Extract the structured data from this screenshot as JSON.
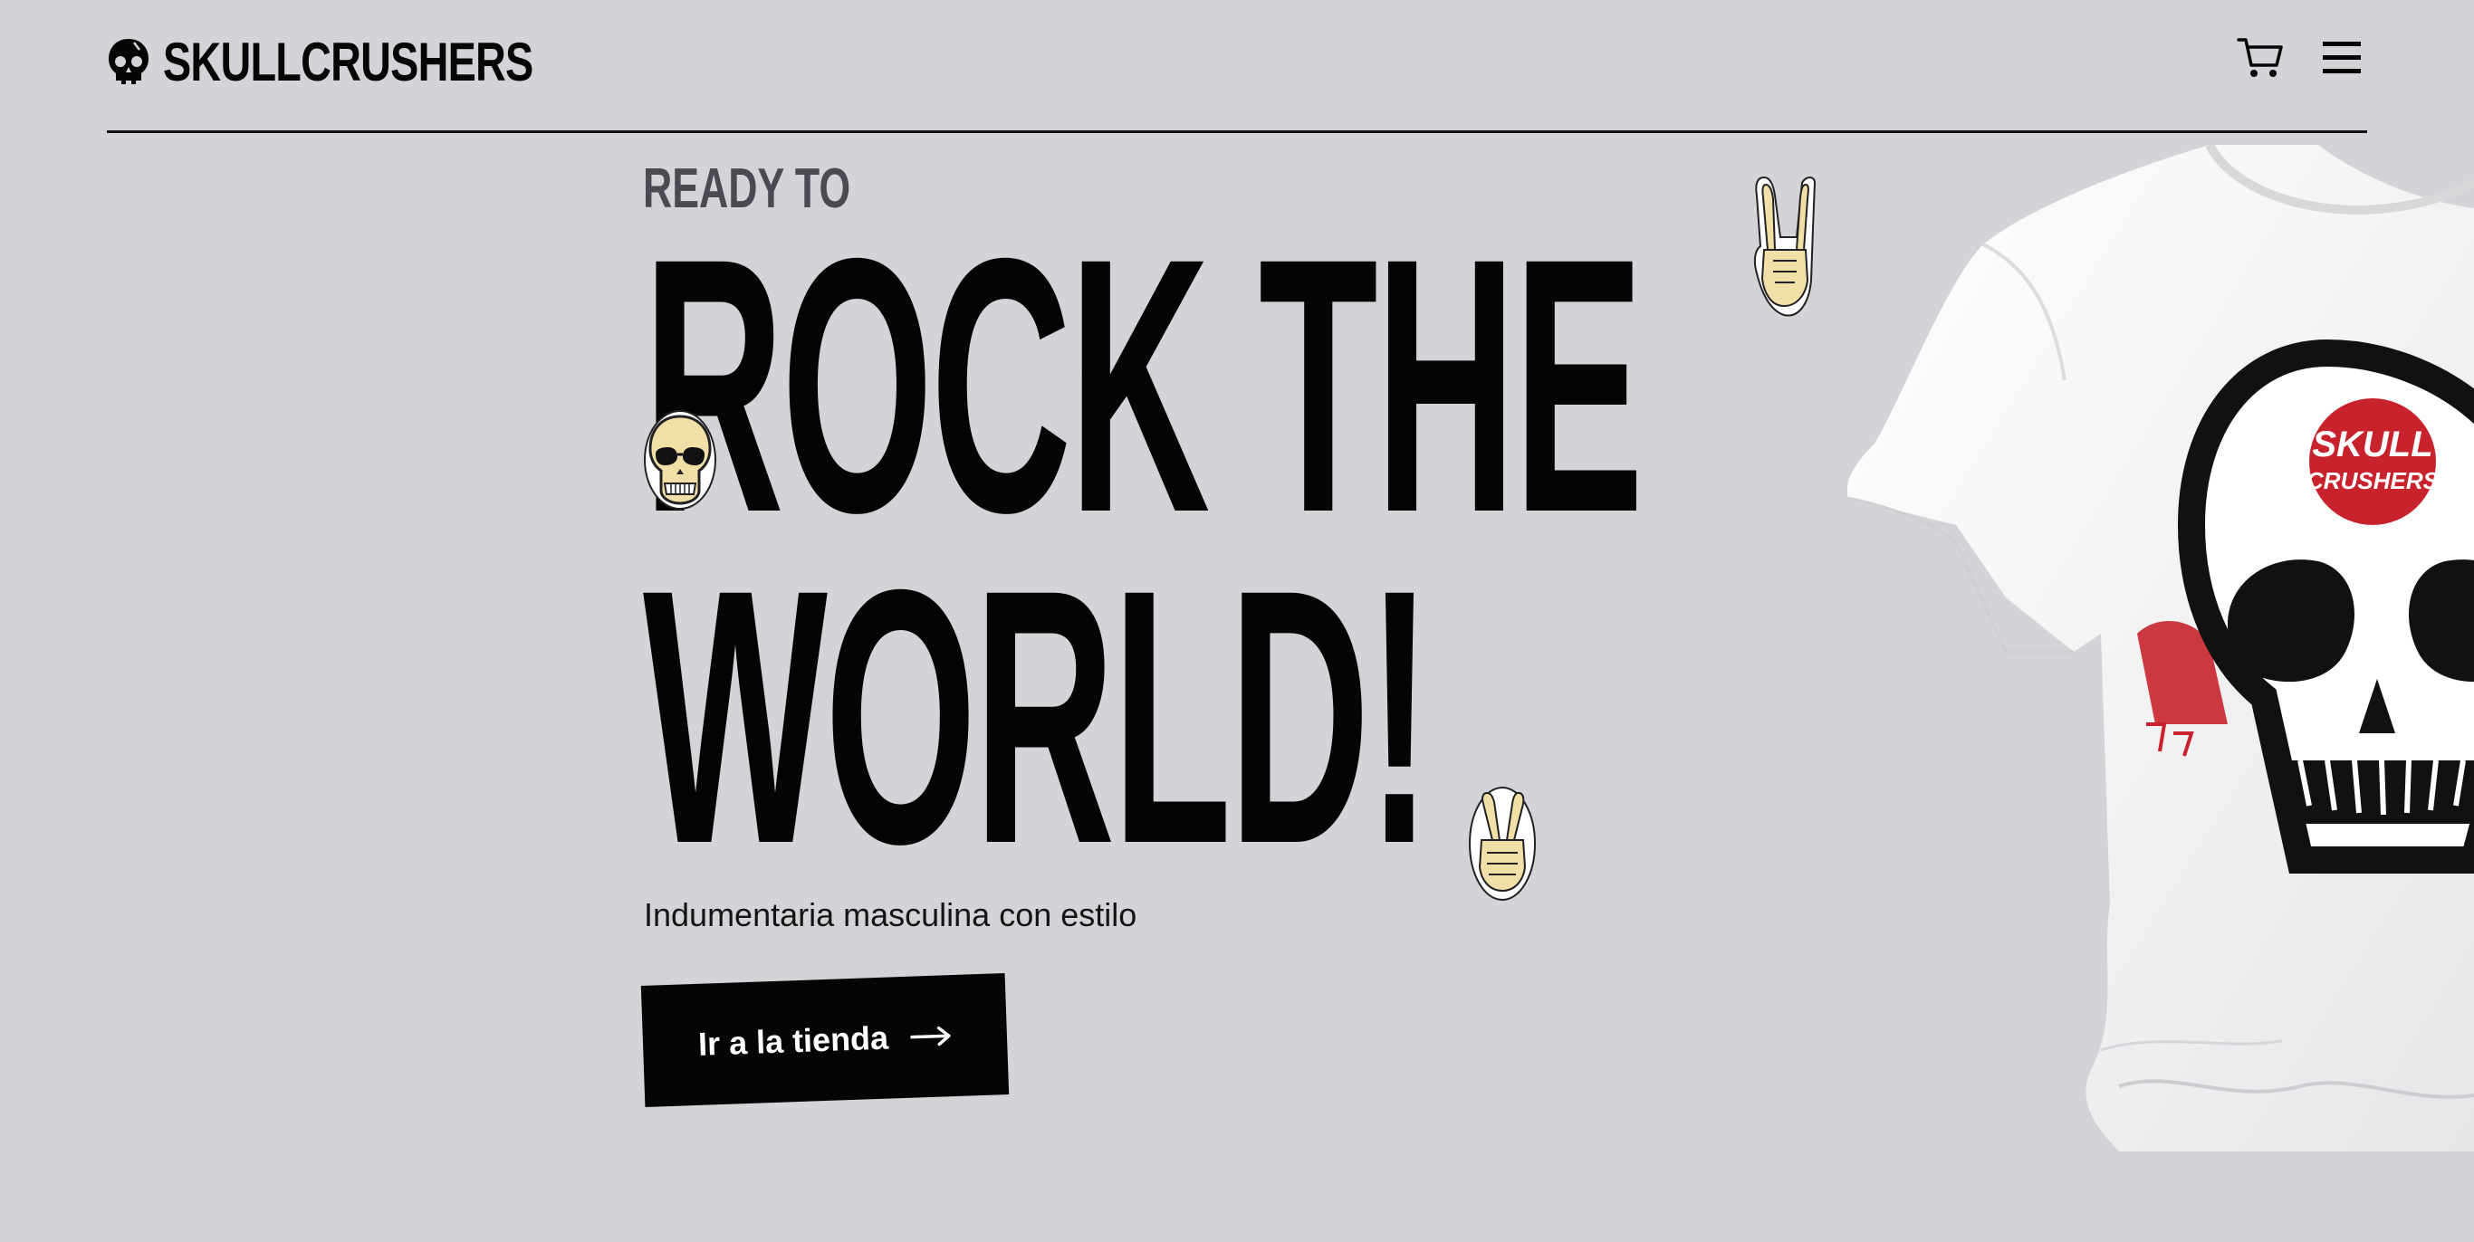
{
  "brand": {
    "name": "SKULLCRUSHERS",
    "logo_icon": "skull-icon"
  },
  "nav": {
    "cart_icon": "cart-icon",
    "menu_icon": "hamburger-menu-icon"
  },
  "hero": {
    "kicker": "READY TO",
    "headline_line1": "ROCK THE",
    "headline_line2": "WORLD!",
    "subtitle": "Indumentaria masculina con estilo",
    "cta_label": "Ir a la tienda",
    "cta_icon": "arrow-right-icon"
  },
  "product": {
    "print_text_line1": "SKULL",
    "print_text_line2": "CRUSHERS"
  },
  "colors": {
    "background": "#d4d4d8",
    "text": "#060606",
    "kicker": "#4a4a52",
    "button": "#050505",
    "sticker_bone": "#f2dfa7",
    "print_red": "#c8232c"
  }
}
